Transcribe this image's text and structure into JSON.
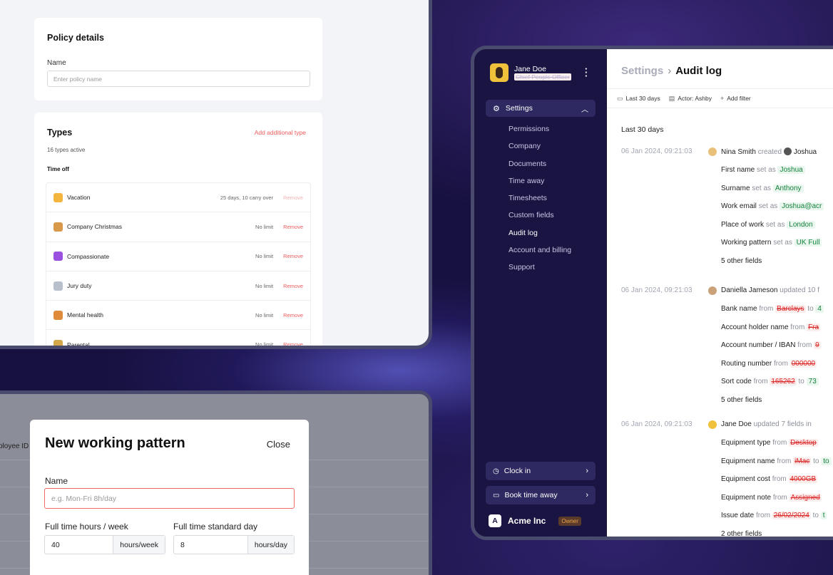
{
  "policy": {
    "details_title": "Policy details",
    "name_label": "Name",
    "name_placeholder": "Enter policy name",
    "types_title": "Types",
    "add_type_link": "Add additional type",
    "types_count": "16 types active",
    "group_label": "Time off",
    "remove_label": "Remove",
    "types": [
      {
        "name": "Vacation",
        "limit": "25 days, 10 carry over",
        "icon": "cat-face-icon",
        "color": "#f4b53f",
        "remove_enabled": false
      },
      {
        "name": "Company Christmas",
        "limit": "No limit",
        "icon": "party-popper-icon",
        "color": "#d89a4a",
        "remove_enabled": true
      },
      {
        "name": "Compassionate",
        "limit": "No limit",
        "icon": "purple-heart-icon",
        "color": "#9b51e0",
        "remove_enabled": true
      },
      {
        "name": "Jury duty",
        "limit": "No limit",
        "icon": "scales-icon",
        "color": "#b8c0cc",
        "remove_enabled": true
      },
      {
        "name": "Mental health",
        "limit": "No limit",
        "icon": "meditation-icon",
        "color": "#e08a3c",
        "remove_enabled": true
      },
      {
        "name": "Parental",
        "limit": "No limit",
        "icon": "family-icon",
        "color": "#d4a74a",
        "remove_enabled": true
      }
    ]
  },
  "working_pattern": {
    "behind_column": "ployee ID",
    "title": "New working pattern",
    "close_label": "Close",
    "name_label": "Name",
    "name_placeholder": "e.g. Mon-Fri 8h/day",
    "hours_label": "Full time hours / week",
    "hours_value": "40",
    "hours_unit": "hours/week",
    "day_label": "Full time standard day",
    "day_value": "8",
    "day_unit": "hours/day"
  },
  "audit": {
    "user": {
      "name": "Jane Doe",
      "role": "Chief People Officer"
    },
    "settings_label": "Settings",
    "menu": [
      "Permissions",
      "Company",
      "Documents",
      "Time away",
      "Timesheets",
      "Custom fields",
      "Audit log",
      "Account and billing",
      "Support"
    ],
    "active_menu": "Audit log",
    "clock_in": "Clock in",
    "book_time_away": "Book time away",
    "org_name": "Acme Inc",
    "org_logo": "A",
    "org_badge": "Owner",
    "breadcrumb_parent": "Settings",
    "breadcrumb_current": "Audit log",
    "filters": {
      "period": "Last 30 days",
      "actor": "Actor: Ashby",
      "add": "Add filter"
    },
    "period_heading": "Last 30 days",
    "events": [
      {
        "timestamp": "06 Jan 2024, 09:21:03",
        "actor": "Nina Smith",
        "action": "created",
        "target": "Joshua",
        "changes": [
          {
            "field": "First name",
            "verb": "set as",
            "to": "Joshua"
          },
          {
            "field": "Surname",
            "verb": "set as",
            "to": "Anthony"
          },
          {
            "field": "Work email",
            "verb": "set as",
            "to": "Joshua@acr"
          },
          {
            "field": "Place of work",
            "verb": "set as",
            "to": "London"
          },
          {
            "field": "Working pattern",
            "verb": "set as",
            "to": "UK Full"
          }
        ],
        "more": "5 other fields"
      },
      {
        "timestamp": "06 Jan 2024, 09:21:03",
        "actor": "Daniella Jameson",
        "action": "updated 10 f",
        "changes": [
          {
            "field": "Bank name",
            "from": "Barclays",
            "to": "4"
          },
          {
            "field": "Account holder name",
            "from": "Fra",
            "to": ""
          },
          {
            "field": "Account number / IBAN",
            "from": "9",
            "to": ""
          },
          {
            "field": "Routing number",
            "from": "000000",
            "to": ""
          },
          {
            "field": "Sort code",
            "from": "165262",
            "to": "73"
          }
        ],
        "more": "5 other fields"
      },
      {
        "timestamp": "06 Jan 2024, 09:21:03",
        "actor": "Jane Doe",
        "action": "updated 7 fields in",
        "changes": [
          {
            "field": "Equipment type",
            "from": "Desktop",
            "to": ""
          },
          {
            "field": "Equipment name",
            "from": "iMac",
            "to": "to"
          },
          {
            "field": "Equipment cost",
            "from": "4000GB",
            "to": ""
          },
          {
            "field": "Equipment note",
            "from": "Assigned",
            "to": ""
          },
          {
            "field": "Issue date",
            "from": "26/02/2024",
            "to": "t"
          }
        ],
        "more": "2 other fields"
      }
    ],
    "from_word": "from",
    "to_word": "to"
  }
}
